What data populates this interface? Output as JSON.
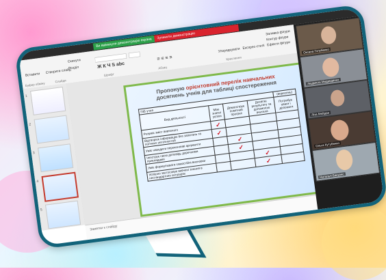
{
  "window": {
    "tab_green": "Ви ввімкнули демонстрацію екрана",
    "tab_red": "Зупинити демонстрацію"
  },
  "ribbon": {
    "paste": "Вставити",
    "new_slide": "Створити слайд",
    "reset": "Скинути",
    "section": "Розділ",
    "group_clipboard": "Буфер обміну",
    "group_slides": "Слайди",
    "group_font": "Шрифт",
    "group_paragraph": "Абзац",
    "group_drawing": "Креслення",
    "arrange": "Упорядкувати",
    "quick_styles": "Експрес-стилі",
    "fill": "Заливка фігури",
    "outline": "Контур фігури",
    "effects": "Ефекти фігури"
  },
  "thumbnails": [
    {
      "num": "1"
    },
    {
      "num": "2"
    },
    {
      "num": "3"
    },
    {
      "num": "4"
    },
    {
      "num": "5"
    }
  ],
  "slide": {
    "title_pre": "Пропоную",
    "title_hl": "орієнтовний перелік навчальних",
    "title_line2": "досягнень учнів для таблиці спостереження",
    "table": {
      "name_label": "ПІБ учня",
      "version_label": "(вересень)",
      "col_activity": "Вид діяльності",
      "col_1": "Має значні успіхи",
      "col_2": "Демонструє помітний прогрес",
      "col_3": "Досягає результату за допомогою вчителя",
      "col_4": "Потребує уваги і допомоги",
      "rows": [
        {
          "label": "Розуміє зміст вивченого",
          "check": 1
        },
        {
          "label": "Відтворює інформацію без запитань та логічних неточностей",
          "check": 1
        },
        {
          "label": "Уміє наводити переконливі аргументи",
          "check": 2
        },
        {
          "label": "Ілюструє свою доповідь доречними прикладами",
          "check": 2
        },
        {
          "label": "Уміє формулювати самостійні висновки",
          "check": 3
        },
        {
          "label": "Успішно застосовує вивчені знання в нестандартних ситуаціях",
          "check": 3
        }
      ]
    }
  },
  "notes": {
    "placeholder": "Заметки к слайду"
  },
  "participants": [
    {
      "name": "Оксана Голубенко"
    },
    {
      "name": "Людмила Медведенко"
    },
    {
      "name": "Ліза Мейдан"
    },
    {
      "name": "Ольга Кутубенко"
    },
    {
      "name": "Наталья Бакурес"
    }
  ],
  "colors": {
    "accent_border": "#12637a",
    "check": "#d0121f",
    "slide_border": "#7fb94a"
  }
}
